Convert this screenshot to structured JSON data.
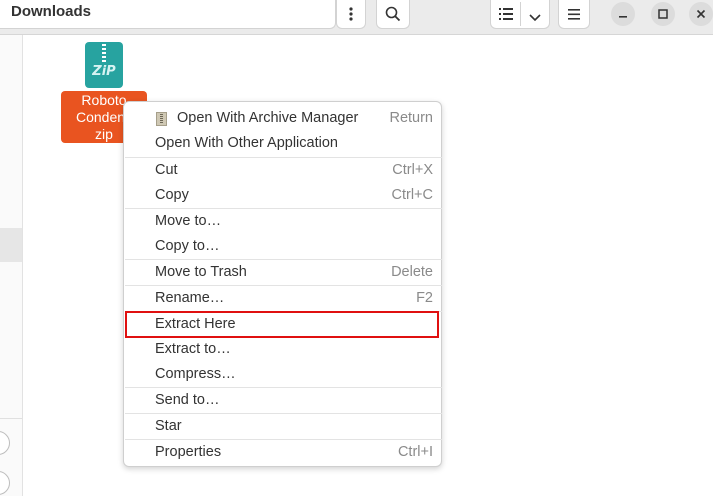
{
  "header": {
    "path_separator": "/",
    "folder_name": "Downloads"
  },
  "icons": {
    "kebab": "vertical-ellipsis-icon",
    "search": "search-icon",
    "list_view": "list-view-icon",
    "view_options": "chevron-down-icon",
    "main_menu": "hamburger-menu-icon",
    "minimize": "minimize-icon",
    "maximize": "maximize-icon",
    "close": "close-icon"
  },
  "file": {
    "icon_text": "ZiP",
    "name_lines": [
      "Roboto",
      "Condens",
      "zip"
    ]
  },
  "context_menu": {
    "items": [
      {
        "label": "Open With Archive Manager",
        "accel": "Return"
      },
      {
        "label": "Open With Other Application",
        "accel": ""
      },
      {
        "label": "Cut",
        "accel": "Ctrl+X"
      },
      {
        "label": "Copy",
        "accel": "Ctrl+C"
      },
      {
        "label": "Move to…",
        "accel": ""
      },
      {
        "label": "Copy to…",
        "accel": ""
      },
      {
        "label": "Move to Trash",
        "accel": "Delete"
      },
      {
        "label": "Rename…",
        "accel": "F2"
      },
      {
        "label": "Extract Here",
        "accel": ""
      },
      {
        "label": "Extract to…",
        "accel": ""
      },
      {
        "label": "Compress…",
        "accel": ""
      },
      {
        "label": "Send to…",
        "accel": ""
      },
      {
        "label": "Star",
        "accel": ""
      },
      {
        "label": "Properties",
        "accel": "Ctrl+I"
      }
    ]
  },
  "colors": {
    "selection_accent": "#e95420",
    "zip_icon": "#27a3a0",
    "highlight_box": "#e01010"
  }
}
